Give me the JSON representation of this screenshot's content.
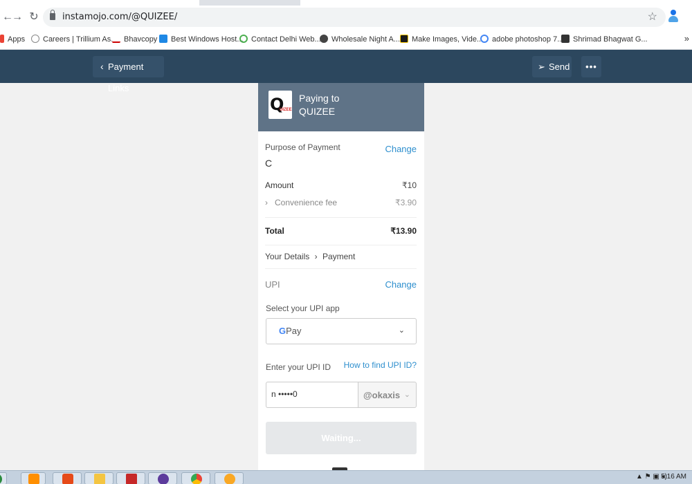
{
  "browser": {
    "url": "instamojo.com/@QUIZEE/",
    "bookmarks": [
      {
        "label": "Apps",
        "icon": "apps-grid-icon"
      },
      {
        "label": "Careers | Trillium As...",
        "icon": "trillium-icon"
      },
      {
        "label": "Bhavcopy",
        "icon": "bse-icon"
      },
      {
        "label": "Best Windows Host...",
        "icon": "m-icon"
      },
      {
        "label": "Contact Delhi Web...",
        "icon": "headset-icon"
      },
      {
        "label": "Wholesale Night A...",
        "icon": "globe-icon"
      },
      {
        "label": "Make Images, Vide...",
        "icon": "s-icon"
      },
      {
        "label": "adobe photoshop 7...",
        "icon": "google-icon"
      },
      {
        "label": "Shrimad Bhagwat G...",
        "icon": "book-icon"
      }
    ],
    "bookmarks_more": "»"
  },
  "header": {
    "back_label": "Payment Links",
    "send_label": "Send",
    "more_label": "•••"
  },
  "card": {
    "logo_letter": "Q",
    "logo_rest": "UIZEE",
    "paying_to_line1": "Paying to",
    "paying_to_line2": "QUIZEE",
    "purpose_label": "Purpose of Payment",
    "purpose_value": "C",
    "change_label": "Change",
    "amount_label": "Amount",
    "amount_value": "₹10",
    "fee_label": "Convenience fee",
    "fee_value": "₹3.90",
    "total_label": "Total",
    "total_value": "₹13.90",
    "step_details": "Your Details",
    "step_payment": "Payment",
    "method_label": "UPI",
    "method_change": "Change",
    "select_app_label": "Select your UPI app",
    "selected_app_g": "G",
    "selected_app_rest": "Pay",
    "upi_id_label": "Enter your UPI ID",
    "find_upi_link": "How to find UPI ID?",
    "upi_id_value": "n •••••0",
    "upi_handle": "@okaxis",
    "submit_label": "Waiting..."
  },
  "taskbar": {
    "time": "5:16 AM"
  },
  "colors": {
    "header_bg": "#2c475e",
    "card_head_bg": "#5f7387",
    "link": "#2e8fce"
  }
}
